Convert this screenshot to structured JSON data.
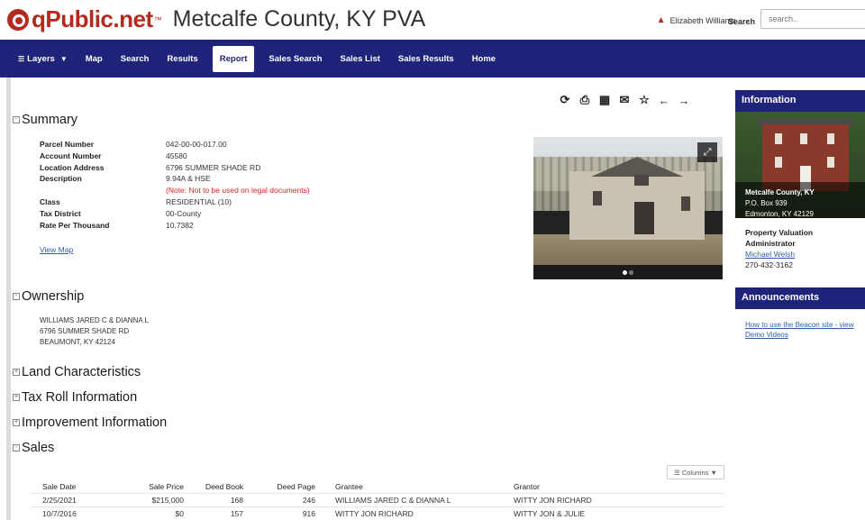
{
  "header": {
    "logo_text": "qPublic.net",
    "logo_tm": "™",
    "site_title": "Metcalfe County, KY PVA",
    "user_name": "Elizabeth Williams",
    "search_label": "Search",
    "search_placeholder": "search.."
  },
  "nav": {
    "items": [
      {
        "label": "Layers"
      },
      {
        "label": "Map"
      },
      {
        "label": "Search"
      },
      {
        "label": "Results"
      },
      {
        "label": "Report"
      },
      {
        "label": "Sales Search"
      },
      {
        "label": "Sales List"
      },
      {
        "label": "Sales Results"
      },
      {
        "label": "Home"
      }
    ],
    "active": "Report"
  },
  "sections": {
    "summary": "Summary",
    "ownership": "Ownership",
    "land": "Land Characteristics",
    "taxroll": "Tax Roll Information",
    "improvement": "Improvement Information",
    "sales": "Sales"
  },
  "summary": {
    "rows": [
      {
        "label": "Parcel Number",
        "value": "042-00-00-017.00"
      },
      {
        "label": "Account Number",
        "value": "45580"
      },
      {
        "label": "Location Address",
        "value": "6796 SUMMER SHADE RD"
      },
      {
        "label": "Description",
        "value": "9.94A & HSE"
      },
      {
        "label": "",
        "value": "(Note: Not to be used on legal documents)"
      },
      {
        "label": "Class",
        "value": "RESIDENTIAL (10)"
      },
      {
        "label": "Tax District",
        "value": "00-County"
      },
      {
        "label": "Rate Per Thousand",
        "value": "10.7382"
      }
    ],
    "view_map": "View Map"
  },
  "ownership": {
    "lines": [
      "WILLIAMS JARED C & DIANNA L",
      "6796 SUMMER SHADE RD",
      "BEAUMONT, KY 42124"
    ]
  },
  "sidebar": {
    "info_title": "Information",
    "office_name": "Metcalfe County, KY",
    "office_box": "P.O. Box 939",
    "office_city": "Edmonton, KY 42129",
    "pva_title_1": "Property Valuation",
    "pva_title_2": "Administrator",
    "pva_name": "Michael Welsh",
    "pva_phone": "270-432-3162",
    "announcements_title": "Announcements",
    "announcement_1": "How to use the Beacon site - view",
    "announcement_2": "Demo Videos"
  },
  "sales": {
    "columns_button": "Columns",
    "headers": [
      "Sale Date",
      "Sale Price",
      "Deed Book",
      "Deed Page",
      "Grantee",
      "Grantor"
    ],
    "rows": [
      [
        "2/25/2021",
        "$215,000",
        "168",
        "246",
        "WILLIAMS JARED C & DIANNA L",
        "WITTY JON RICHARD"
      ],
      [
        "10/7/2016",
        "$0",
        "157",
        "916",
        "WITTY JON RICHARD",
        "WITTY JON & JULIE"
      ]
    ]
  },
  "colors": {
    "brand_red": "#b52a1f",
    "nav_blue": "#20237a",
    "link_blue": "#2f5fa7"
  },
  "icons": [
    "share-icon",
    "print-icon",
    "image-icon",
    "email-icon",
    "star-icon",
    "back-arrow-icon",
    "forward-arrow-icon"
  ]
}
